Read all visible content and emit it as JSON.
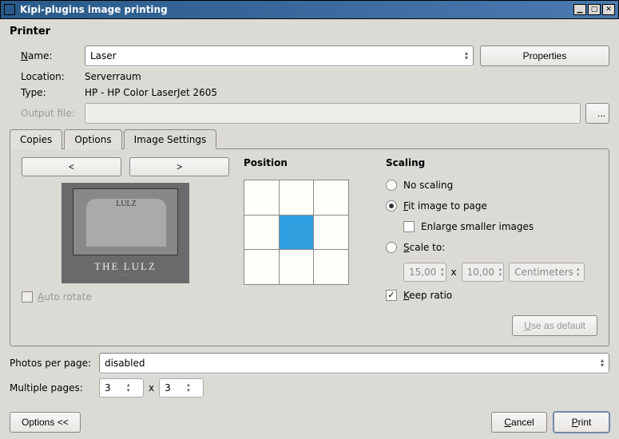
{
  "window": {
    "title": "Kipi-plugins image printing"
  },
  "printer": {
    "section_title": "Printer",
    "name_label": "Name:",
    "name_value": "Laser",
    "properties_btn": "Properties",
    "location_label": "Location:",
    "location_value": "Serverraum",
    "type_label": "Type:",
    "type_value": "HP - HP Color LaserJet 2605",
    "output_label": "Output file:",
    "output_value": "",
    "output_browse": "..."
  },
  "tabs": {
    "copies": "Copies",
    "options": "Options",
    "image_settings": "Image Settings"
  },
  "preview": {
    "prev_btn": "<",
    "next_btn": ">",
    "tombstone": "LULZ",
    "caption": "THE LULZ",
    "auto_rotate": "Auto rotate"
  },
  "position": {
    "header": "Position",
    "selected_index": 4
  },
  "scaling": {
    "header": "Scaling",
    "no_scaling": "No scaling",
    "fit": "Fit image to page",
    "enlarge": "Enlarge smaller images",
    "scale_to": "Scale to:",
    "w": "15,00",
    "x": "x",
    "h": "10,00",
    "unit": "Centimeters",
    "keep_ratio": "Keep ratio",
    "use_default": "Use as default"
  },
  "lower": {
    "ppp_label": "Photos per page:",
    "ppp_value": "disabled",
    "mp_label": "Multiple pages:",
    "mp_cols": "3",
    "mp_x": "x",
    "mp_rows": "3"
  },
  "footer": {
    "options_btn": "Options <<",
    "cancel": "Cancel",
    "print": "Print"
  }
}
